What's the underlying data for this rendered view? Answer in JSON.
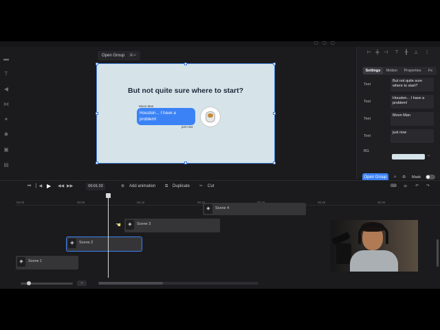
{
  "canvas": {
    "chip_label": "Open Group",
    "chip_shortcut": "⌘↵",
    "title": "But not quite sure where to start?",
    "message": {
      "sender": "Moon Man",
      "text": "Houston... I have a problem!",
      "time": "just now"
    }
  },
  "panel": {
    "tabs": [
      {
        "label": "Settings",
        "active": true
      },
      {
        "label": "Motion",
        "active": false
      },
      {
        "label": "Properties",
        "active": false
      },
      {
        "label": "Fx",
        "active": false
      }
    ],
    "rows": [
      {
        "label": "Text",
        "value": "But not quite sure where to start?"
      },
      {
        "label": "Text",
        "value": "Houston... I have a problem!"
      },
      {
        "label": "Text",
        "value": "Moon Man"
      },
      {
        "label": "Text",
        "value": "just now"
      }
    ],
    "bg_label": "BG",
    "bg_color": "#d6e4ea",
    "open_group_button": "Open Group",
    "mask_label": "Mask"
  },
  "timeline": {
    "current_time": "00:01:23",
    "add_animation": "Add animation",
    "duplicate": "Duplicate",
    "cut": "Cut",
    "ticks": [
      "00:00",
      "00:05",
      "00:10",
      "00:15",
      "00:20",
      "00:25",
      "00:30"
    ],
    "clips": [
      {
        "label": "Scene 4"
      },
      {
        "label": "Scene 3"
      },
      {
        "label": "Scene 2"
      },
      {
        "label": "Scene 1"
      }
    ]
  },
  "colors": {
    "accent": "#3b82f6",
    "canvas_bg": "#d6e4ea"
  }
}
